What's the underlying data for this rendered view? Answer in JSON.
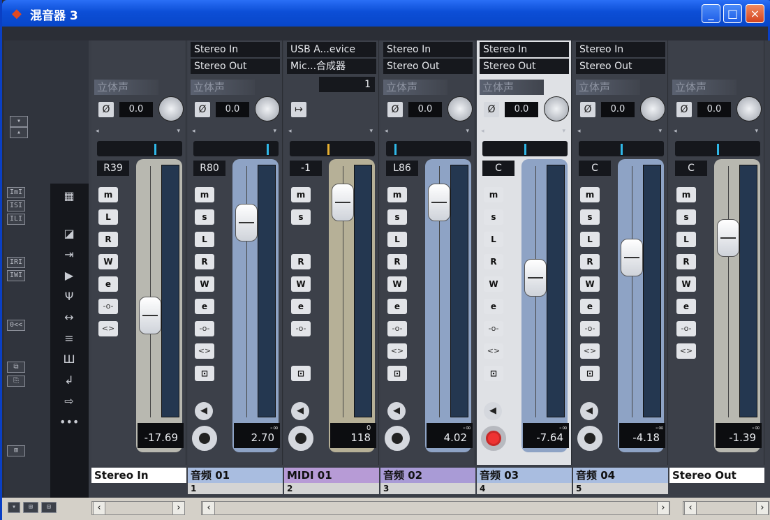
{
  "window": {
    "title": "混音器 3",
    "controls": [
      "_",
      "□",
      "×"
    ]
  },
  "left_buttons": [
    "ImI",
    "ISI",
    "ILI",
    "IRI",
    "IWI",
    "0<<"
  ],
  "strips": [
    {
      "routing_in": "",
      "routing_out": "",
      "stereo": "立体声",
      "gain": "0.0",
      "pan": "R39",
      "volume": "-17.69",
      "peak": "",
      "name": "Stereo In",
      "num": "",
      "handle_pos": 0.52,
      "meter_color": "#b8b8b0",
      "buttons": [
        "m",
        "L",
        "R",
        "W",
        "e",
        "-o-",
        "<>"
      ],
      "name_bg": "#ffffff",
      "rec": false
    },
    {
      "routing_in": "Stereo In",
      "routing_out": "Stereo Out",
      "stereo": "立体声",
      "gain": "0.0",
      "pan": "R80",
      "volume": "2.70",
      "peak": "-∞",
      "name": "音频 01",
      "num": "1",
      "handle_pos": 0.15,
      "meter_color": "#8ea3c5",
      "buttons": [
        "m",
        "s",
        "L",
        "R",
        "W",
        "e",
        "-o-",
        "<>",
        "⊡"
      ],
      "name_bg": "#a9bde0",
      "rec": false
    },
    {
      "routing_in": "USB A...evice",
      "routing_out": "Mic...合成器",
      "stereo": "",
      "gain": "",
      "pan": "-1",
      "volume": "118",
      "peak": "0",
      "name": "MIDI 01",
      "num": "2",
      "handle_pos": 0.07,
      "meter_color": "#b6b097",
      "buttons": [
        "m",
        "s",
        "",
        "R",
        "W",
        "e",
        "-o-",
        "",
        "⊡"
      ],
      "name_bg": "#b79bd6",
      "rec": false,
      "midi_ch": "1"
    },
    {
      "routing_in": "Stereo In",
      "routing_out": "Stereo Out",
      "stereo": "立体声",
      "gain": "0.0",
      "pan": "L86",
      "volume": "4.02",
      "peak": "-∞",
      "name": "音频 02",
      "num": "3",
      "handle_pos": 0.07,
      "meter_color": "#8ea3c5",
      "buttons": [
        "m",
        "s",
        "L",
        "R",
        "W",
        "e",
        "-o-",
        "<>",
        "⊡"
      ],
      "name_bg": "#a99bd6",
      "rec": false
    },
    {
      "routing_in": "Stereo In",
      "routing_out": "Stereo Out",
      "stereo": "立体声",
      "gain": "0.0",
      "pan": "C",
      "volume": "-7.64",
      "peak": "-∞",
      "name": "音频 03",
      "num": "4",
      "handle_pos": 0.37,
      "meter_color": "#8ea3c5",
      "buttons": [
        "m",
        "s",
        "L",
        "R",
        "W",
        "e",
        "-o-",
        "<>",
        "⊡"
      ],
      "name_bg": "#a9bde0",
      "rec": true
    },
    {
      "routing_in": "Stereo In",
      "routing_out": "Stereo Out",
      "stereo": "立体声",
      "gain": "0.0",
      "pan": "C",
      "volume": "-4.18",
      "peak": "-∞",
      "name": "音频 04",
      "num": "5",
      "handle_pos": 0.29,
      "meter_color": "#8ea3c5",
      "buttons": [
        "m",
        "s",
        "L",
        "R",
        "W",
        "e",
        "-o-",
        "<>",
        "⊡"
      ],
      "name_bg": "#a9bde0",
      "rec": false
    },
    {
      "routing_in": "",
      "routing_out": "",
      "stereo": "立体声",
      "gain": "0.0",
      "pan": "C",
      "volume": "-1.39",
      "peak": "-∞",
      "name": "Stereo Out",
      "num": "",
      "handle_pos": 0.21,
      "meter_color": "#b8b8b0",
      "buttons": [
        "m",
        "s",
        "L",
        "R",
        "W",
        "e",
        "-o-",
        "<>"
      ],
      "name_bg": "#ffffff",
      "rec": false
    }
  ]
}
